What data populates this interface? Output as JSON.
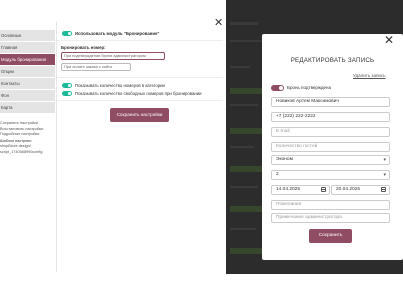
{
  "settings": {
    "sidebar": [
      {
        "label": "Основные"
      },
      {
        "label": "Главная"
      },
      {
        "label": "Модуль бронирования"
      },
      {
        "label": "Опции"
      },
      {
        "label": "Контакты"
      },
      {
        "label": "Фон"
      },
      {
        "label": "Карта"
      }
    ],
    "links": {
      "save_settings": "Сохранить настройки",
      "restore_settings": "Восстановить настройки",
      "advanced_settings": "Подробные настройки",
      "template_settings_label": "Шаблон настроек:",
      "template_name": "shopBlock design/",
      "template_code": "script_1740568990config"
    },
    "use_booking_module_label": "Использовать модуль \"Бронирование\"",
    "book_number_label": "Бронировать номер:",
    "book_option_admin": "При подтверждении брони администратором",
    "book_option_payment": "При оплате заказа с сайта",
    "show_count_label": "Показывать количество номеров в категории",
    "show_free_count_label": "Показывать количество свободных номеров при бронировании",
    "save_button": "Сохранить настройки"
  },
  "modal": {
    "title": "РЕДАКТИРОВАТЬ ЗАПИСЬ",
    "delete_link": "Удалить запись",
    "confirmed_label": "Бронь подтверждена",
    "confirmed": true,
    "name_value": "Новиков Артем Максимович",
    "phone_value": "+7 (222) 222-2222",
    "email_placeholder": "E-mail",
    "guests_placeholder": "Количество гостей",
    "room_type": "Эконом",
    "room_count": "2",
    "date_from": "14.04.2025",
    "date_to": "20.04.2025",
    "wishes_placeholder": "Пожелания",
    "admin_note_placeholder": "Примечание администратора",
    "save_button": "Сохранить"
  },
  "colors": {
    "accent": "#8f4c63",
    "toggle_on": "#1fb99a",
    "overlay": "#2c2c2c"
  }
}
